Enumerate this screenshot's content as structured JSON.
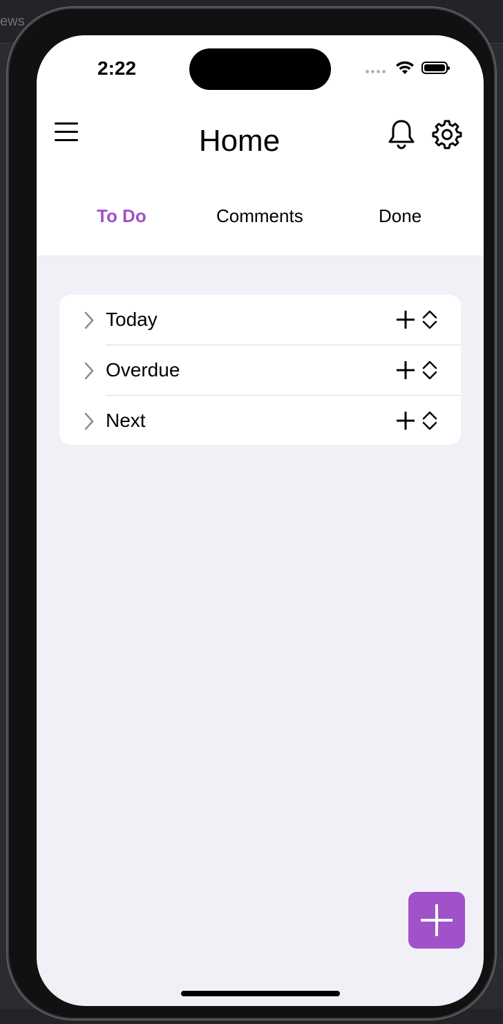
{
  "ide": {
    "breadcrumb": "ews"
  },
  "status_bar": {
    "time": "2:22"
  },
  "header": {
    "title": "Home"
  },
  "tabs": [
    {
      "label": "To Do",
      "active": true
    },
    {
      "label": "Comments",
      "active": false
    },
    {
      "label": "Done",
      "active": false
    }
  ],
  "sections": [
    {
      "label": "Today"
    },
    {
      "label": "Overdue"
    },
    {
      "label": "Next"
    }
  ],
  "colors": {
    "accent": "#a052c9",
    "background": "#f1f0f7"
  },
  "icons": {
    "menu": "hamburger-menu-icon",
    "notifications": "bell-icon",
    "settings": "gear-icon",
    "expand": "chevron-right-icon",
    "add": "plus-icon",
    "reorder": "chevron-up-down-icon",
    "fab": "plus-icon"
  }
}
